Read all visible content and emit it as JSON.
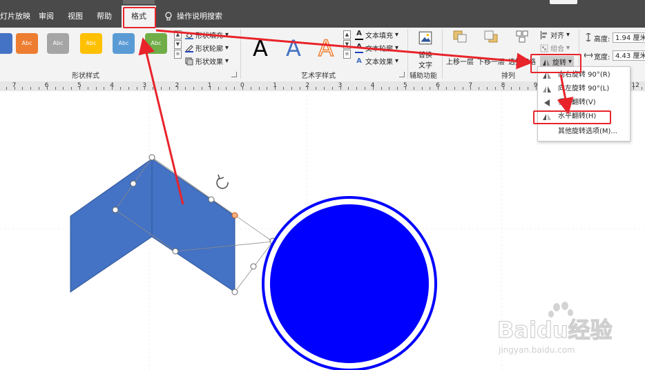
{
  "tabs": [
    {
      "label": "灯片放映"
    },
    {
      "label": "审阅"
    },
    {
      "label": "视图"
    },
    {
      "label": "帮助"
    },
    {
      "label": "格式"
    },
    {
      "label": "操作说明搜索"
    }
  ],
  "ribbon": {
    "shape_style_swatches": [
      {
        "label": "Abc",
        "color": "#ed7d31"
      },
      {
        "label": "Abc",
        "color": "#a5a5a5"
      },
      {
        "label": "Abc",
        "color": "#ffc000"
      },
      {
        "label": "Abc",
        "color": "#5b9bd5"
      },
      {
        "label": "Abc",
        "color": "#70ad47"
      }
    ],
    "shape_fill": "形状填充",
    "shape_outline": "形状轮廓",
    "shape_effects": "形状效果",
    "shape_styles_group": "形状样式",
    "wordart_letter": "A",
    "text_fill": "文本填充",
    "text_outline": "文本轮廓",
    "text_effects": "文本效果",
    "wordart_group": "艺术字样式",
    "alt_text_line1": "替换",
    "alt_text_line2": "文字",
    "accessibility_group": "辅助功能",
    "bring_forward": "上移一层",
    "send_backward": "下移一层",
    "selection_pane": "选择窗格",
    "align": "对齐",
    "group": "组合",
    "rotate": "旋转",
    "arrange_group": "排列",
    "height_label": "高度:",
    "height_value": "1.94 厘米",
    "width_label": "宽度:",
    "width_value": "4.43 厘米"
  },
  "ruler": {
    "labels": [
      "7",
      "6",
      "5",
      "4",
      "3",
      "2",
      "1",
      "0",
      "1",
      "2",
      "3",
      "4",
      "5",
      "6",
      "7",
      "8",
      "9",
      "10",
      "11",
      "12"
    ]
  },
  "rotate_menu": {
    "items": [
      {
        "label": "向右旋转 90°(R)"
      },
      {
        "label": "向左旋转 90°(L)"
      },
      {
        "label": "垂直翻转(V)"
      },
      {
        "label": "水平翻转(H)"
      },
      {
        "label": "其他旋转选项(M)..."
      }
    ]
  },
  "canvas": {
    "shape_fill_color": "#4472c4",
    "circle_color": "#0000ff"
  },
  "watermark": {
    "brand": "Baidu经验",
    "url": "jingyan.baidu.com"
  }
}
